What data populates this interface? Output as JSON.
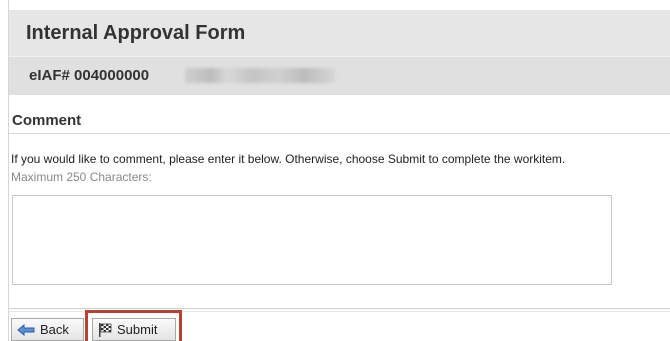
{
  "header": {
    "title": "Internal Approval Form",
    "eiaf_label": "eIAF# 004000000"
  },
  "comment": {
    "heading": "Comment",
    "instructions": "If you would like to comment, please enter it below. Otherwise, choose Submit to complete the workitem.",
    "max_chars_label": "Maximum 250 Characters:",
    "value": ""
  },
  "footer": {
    "back_label": "Back",
    "submit_label": "Submit"
  },
  "icons": {
    "back": "left-arrow-icon",
    "submit": "checkered-flag-icon"
  },
  "colors": {
    "highlight": "#b8422f",
    "header_bg": "#e6e6e6",
    "back_arrow": "#3b73c8"
  }
}
